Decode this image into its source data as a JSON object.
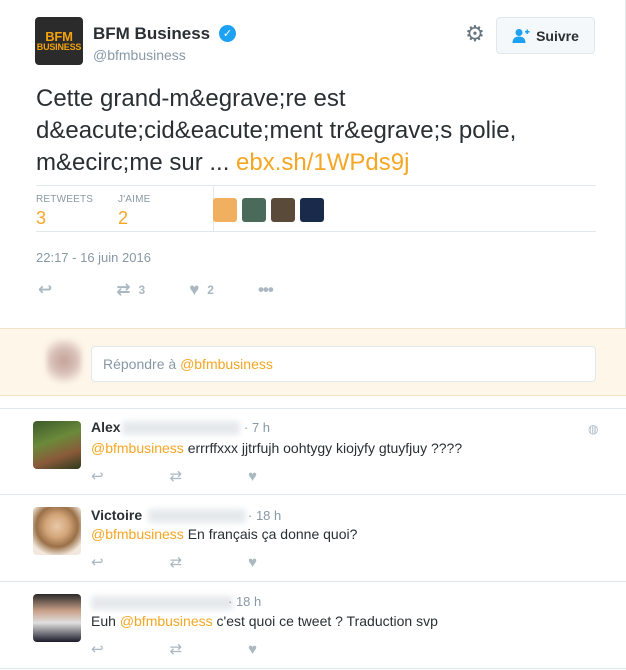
{
  "account": {
    "name": "BFM Business",
    "handle": "@bfmbusiness",
    "logo_line1": "BFM",
    "logo_line2": "BUSINESS",
    "verified_icon": "verified-badge-icon"
  },
  "header": {
    "follow_label": "Suivre",
    "settings_icon": "gear-icon"
  },
  "tweet": {
    "text": "Cette grand-m&egrave;re est d&eacute;cid&eacute;ment tr&egrave;s polie, m&ecirc;me sur ...",
    "link": "ebx.sh/1WPds9j",
    "retweets_label": "RETWEETS",
    "retweets_count": "3",
    "likes_label": "J'AIME",
    "likes_count": "2",
    "timestamp": "22:17 - 16 juin 2016",
    "action_retweet_count": "3",
    "action_like_count": "2"
  },
  "reply_box": {
    "placeholder_prefix": "Répondre à ",
    "placeholder_mention": "@bfmbusiness"
  },
  "replies": [
    {
      "name": "Alex",
      "time": "· 7 h",
      "mention": "@bfmbusiness",
      "text": " errrffxxx jjtrfujh oohtygy kiojyfy  gtuyfjuy ????"
    },
    {
      "name": "Victoire",
      "time": "· 18 h",
      "mention": "@bfmbusiness",
      "text": " En français ça donne quoi?"
    },
    {
      "name": "",
      "time": "· 18 h",
      "prefix": "Euh ",
      "mention": "@bfmbusiness",
      "text": " c'est quoi ce tweet ? Traduction svp"
    }
  ],
  "colors": {
    "accent": "#f5a623",
    "muted": "#8899a6",
    "reply_box_bg": "#fef6e9"
  }
}
